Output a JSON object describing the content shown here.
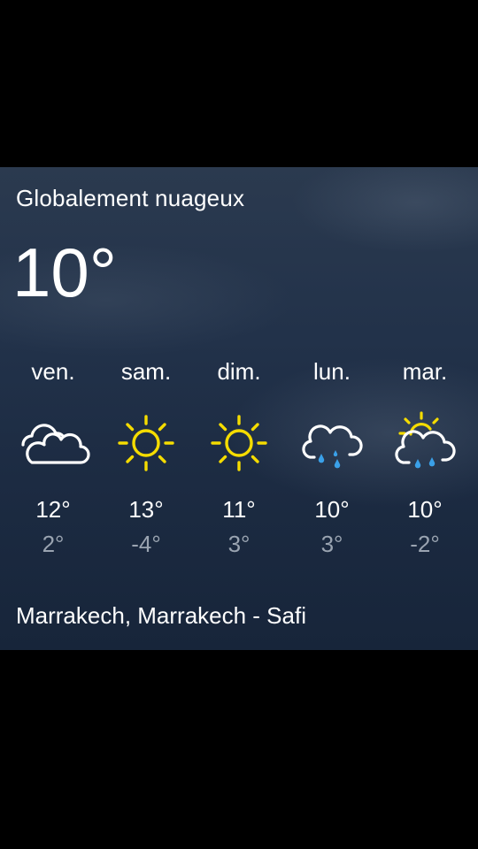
{
  "tile": {
    "condition": "Globalement nuageux",
    "current_temp": "10°",
    "location": "Marrakech, Marrakech - Safi"
  },
  "forecast": [
    {
      "day": "ven.",
      "icon": "cloudy-icon",
      "high": "12°",
      "low": "2°"
    },
    {
      "day": "sam.",
      "icon": "sun-icon",
      "high": "13°",
      "low": "-4°"
    },
    {
      "day": "dim.",
      "icon": "sun-icon",
      "high": "11°",
      "low": "3°"
    },
    {
      "day": "lun.",
      "icon": "rain-cloud-icon",
      "high": "10°",
      "low": "3°"
    },
    {
      "day": "mar.",
      "icon": "sun-rain-cloud-icon",
      "high": "10°",
      "low": "-2°"
    }
  ],
  "colors": {
    "sun": "#f5dc00",
    "rain": "#3aa0e8",
    "low_temp": "#9aa4b1",
    "text": "#ffffff"
  }
}
